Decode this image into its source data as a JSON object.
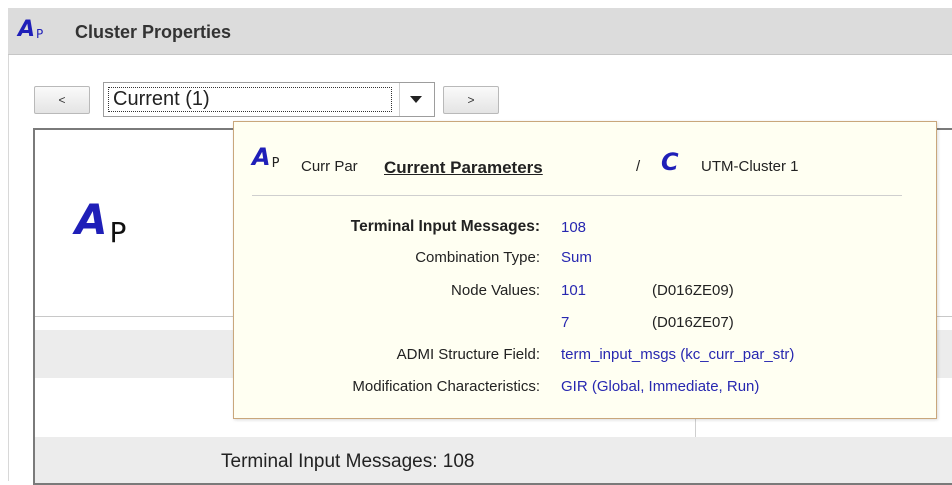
{
  "window": {
    "title": "Cluster Properties",
    "logo_main": "A",
    "logo_sub": "P"
  },
  "nav": {
    "prev_label": "<",
    "next_label": ">",
    "select_value": "Current (1)"
  },
  "card": {
    "logo_main": "A",
    "logo_sub": "P",
    "row_label": "Terminal Input Messages:",
    "row_value": "108"
  },
  "tooltip": {
    "logo_main": "A",
    "logo_sub": "P",
    "short_name": "Curr Par",
    "link_text": "Current Parameters",
    "separator": "/",
    "cluster_icon": "C",
    "cluster_name": "UTM-Cluster 1",
    "details": {
      "terminal_input_label": "Terminal Input Messages:",
      "terminal_input_value": "108",
      "combination_label": "Combination Type:",
      "combination_value": "Sum",
      "node_values_label": "Node Values:",
      "node_values": [
        {
          "value": "101",
          "node": "(D016ZE09)"
        },
        {
          "value": "7",
          "node": "(D016ZE07)"
        }
      ],
      "admi_label": "ADMI Structure Field:",
      "admi_value": "term_input_msgs (kc_curr_par_str)",
      "modification_label": "Modification Characteristics:",
      "modification_value": "GIR (Global, Immediate, Run)"
    }
  },
  "colors": {
    "accent_blue": "#1f1fb8",
    "value_blue": "#2727b0",
    "tooltip_bg": "#fffff2",
    "tooltip_border": "#c9a77c"
  }
}
